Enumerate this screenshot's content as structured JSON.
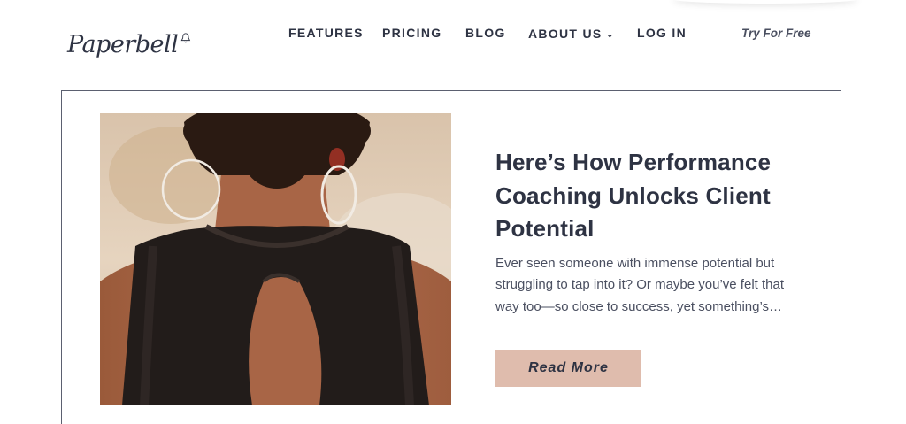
{
  "header": {
    "logo_text": "Paperbell",
    "nav": {
      "features": "FEATURES",
      "pricing": "PRICING",
      "blog": "BLOG",
      "about": "ABOUT US",
      "login": "LOG IN"
    },
    "cta": "Try For Free"
  },
  "post": {
    "title": "Here’s How Performance Coaching Unlocks Client Potential",
    "excerpt": "Ever seen someone with immense potential but struggling to tap into it? Or maybe you’ve felt that way too—so close to success, yet something’s…",
    "read_more": "Read More"
  },
  "colors": {
    "text_dark": "#2e3343",
    "button_bg": "#dfbcad",
    "card_border": "#5b6070"
  }
}
